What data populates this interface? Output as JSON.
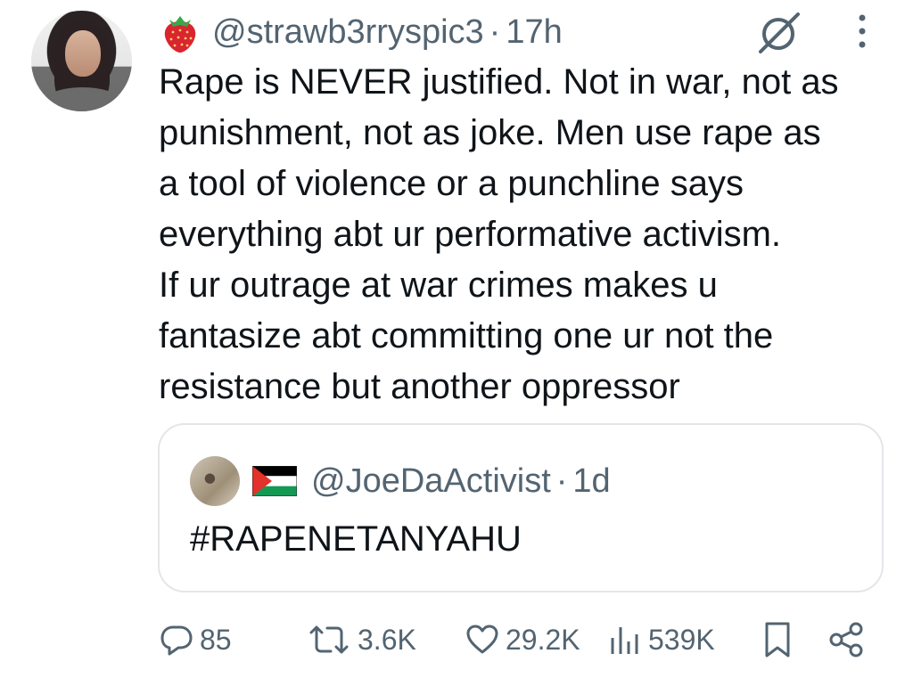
{
  "tweet": {
    "author_handle": "@strawb3rryspic3",
    "separator": "·",
    "time_ago": "17h",
    "text": "Rape is NEVER justified. Not in war, not as\npunishment, not as joke. Men use rape as\na tool of violence or a punchline says\neverything abt ur performative activism.\nIf ur outrage at war crimes makes u\nfantasize abt committing one ur not the\nresistance but another oppressor"
  },
  "quoted_tweet": {
    "author_handle": "@JoeDaActivist",
    "separator": "·",
    "time_ago": "1d",
    "text": "#RAPENETANYAHU"
  },
  "actions": {
    "replies": "85",
    "reposts": "3.6K",
    "likes": "29.2K",
    "views": "539K"
  },
  "icons": [
    "strawberry-emoji",
    "grok-icon",
    "more-icon",
    "palestine-flag-emoji",
    "reply-icon",
    "repost-icon",
    "like-icon",
    "views-icon",
    "bookmark-icon",
    "share-icon"
  ],
  "colors": {
    "text": "#0f1419",
    "secondary": "#536471",
    "border": "#e3e6e9"
  }
}
